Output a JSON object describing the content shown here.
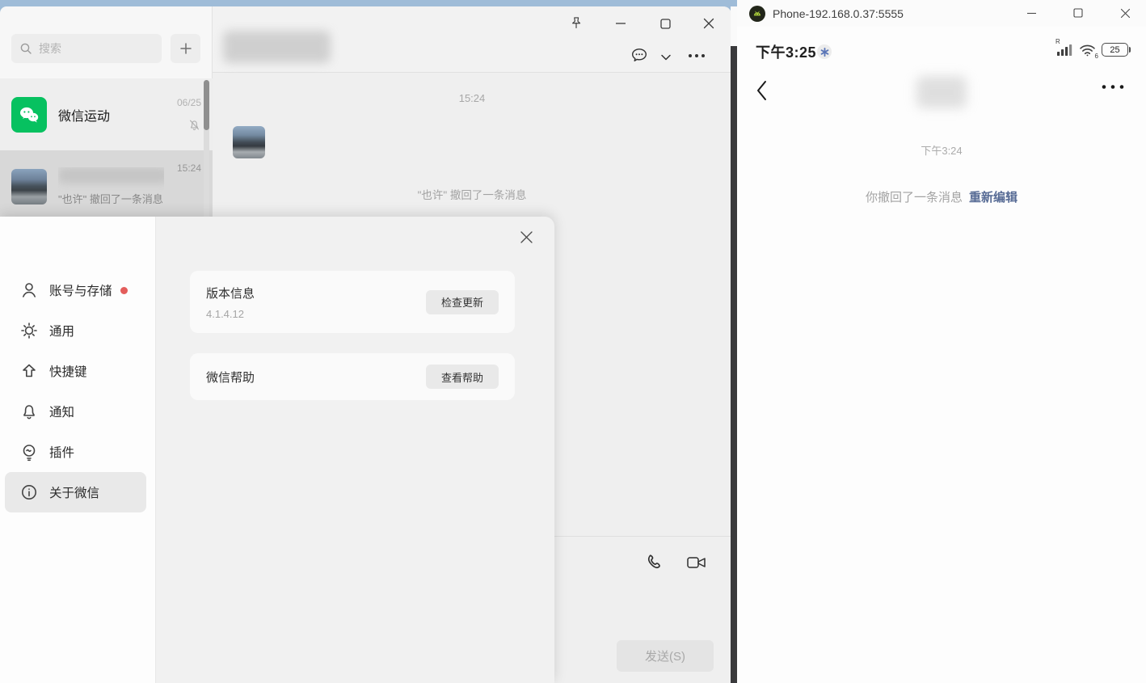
{
  "colors": {
    "desktop": "#9fbcd8",
    "wechat_green": "#07c160",
    "link_blue": "#576b95",
    "alert_red": "#e35d5b"
  },
  "main_window": {
    "search": {
      "placeholder": "搜索"
    },
    "chat_list": [
      {
        "name": "微信运动",
        "date": "06/25"
      },
      {
        "time": "15:24",
        "preview": "\"也许\" 撤回了一条消息"
      }
    ]
  },
  "chat_window": {
    "timestamp": "15:24",
    "recall_message": "\"也许\" 撤回了一条消息",
    "send_button": "发送(S)"
  },
  "settings_window": {
    "sidebar_items": [
      "账号与存储",
      "通用",
      "快捷键",
      "通知",
      "插件",
      "关于微信"
    ],
    "about": {
      "version_title": "版本信息",
      "version_value": "4.1.4.12",
      "check_update": "检查更新",
      "help_title": "微信帮助",
      "view_help": "查看帮助"
    }
  },
  "phone_window": {
    "title": "Phone-192.168.0.37:5555",
    "status_bar": {
      "time": "下午3:25",
      "signal_badge": "R",
      "wifi_badge": "6",
      "battery": "25"
    },
    "chat": {
      "timestamp": "下午3:24",
      "recall_message": "你撤回了一条消息",
      "reedit_link": "重新编辑"
    }
  }
}
